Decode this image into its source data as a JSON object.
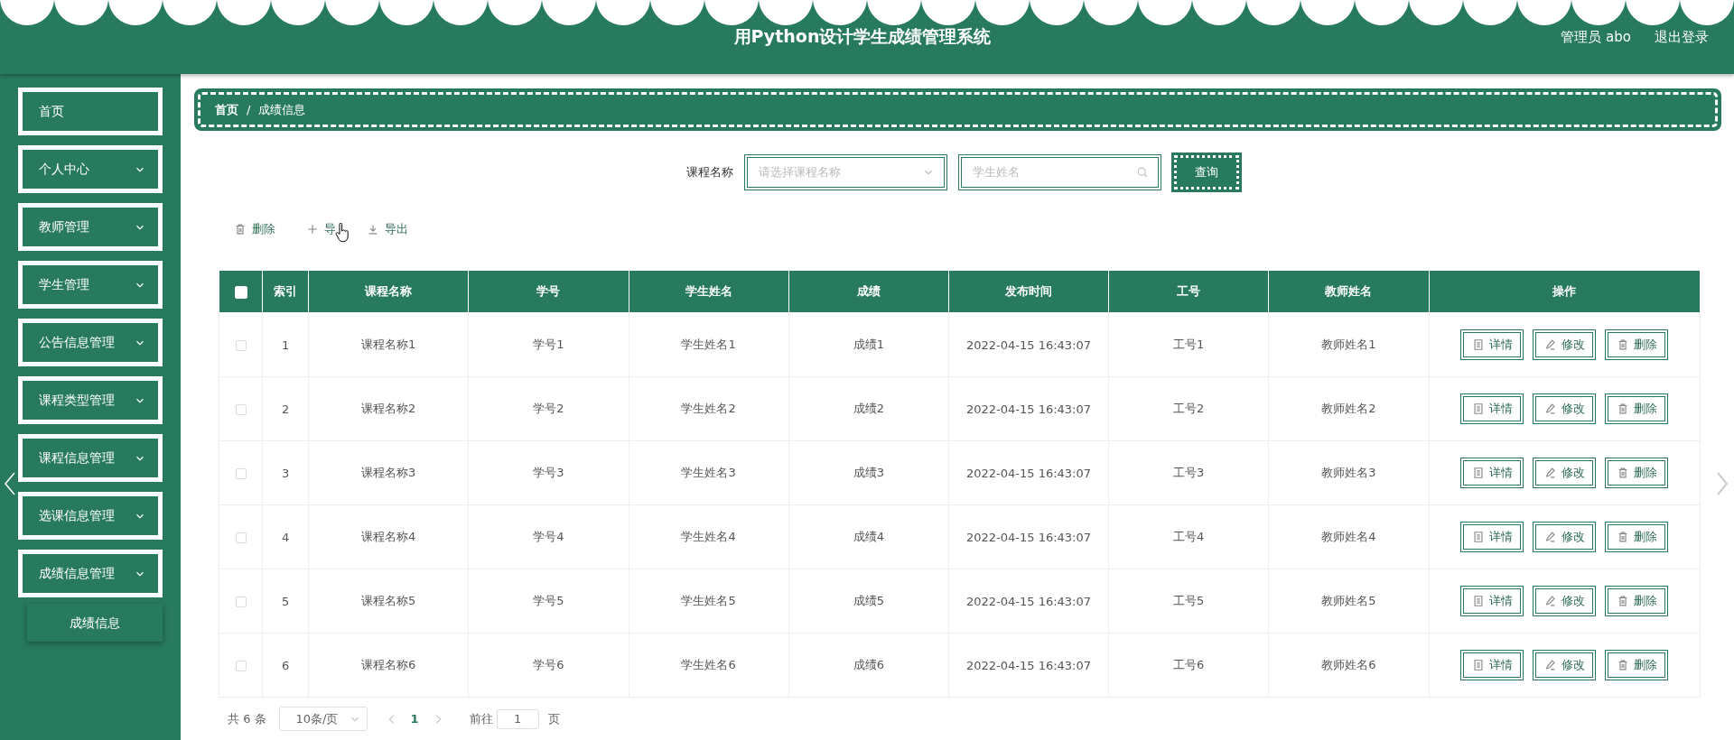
{
  "header": {
    "title": "用Python设计学生成绩管理系统",
    "user": "管理员 abo",
    "logout": "退出登录"
  },
  "sidebar": {
    "items": [
      {
        "label": "首页",
        "kind": "link"
      },
      {
        "label": "个人中心",
        "kind": "submenu"
      },
      {
        "label": "教师管理",
        "kind": "submenu"
      },
      {
        "label": "学生管理",
        "kind": "submenu"
      },
      {
        "label": "公告信息管理",
        "kind": "submenu"
      },
      {
        "label": "课程类型管理",
        "kind": "submenu"
      },
      {
        "label": "课程信息管理",
        "kind": "submenu"
      },
      {
        "label": "选课信息管理",
        "kind": "submenu"
      },
      {
        "label": "成绩信息管理",
        "kind": "submenu",
        "children": [
          {
            "label": "成绩信息"
          }
        ]
      }
    ]
  },
  "breadcrumb": [
    "首页",
    "/",
    "成绩信息"
  ],
  "search": {
    "label": "课程名称",
    "course_select": {
      "placeholder": "请选择课程名称"
    },
    "name_field": {
      "placeholder": "学生姓名"
    },
    "button": "查询"
  },
  "toolbar": [
    {
      "kind": "delete",
      "label": "删除"
    },
    {
      "kind": "add",
      "label": "导"
    },
    {
      "kind": "export",
      "label": "导出"
    }
  ],
  "table": {
    "select_all": {
      "checked": false
    },
    "columns": [
      "索引",
      "课程名称",
      "学号",
      "学生姓名",
      "成绩",
      "发布时间",
      "工号",
      "教师姓名",
      "操作"
    ],
    "rows": [
      {
        "checked": false,
        "cells": [
          "1",
          "课程名称1",
          "学号1",
          "学生姓名1",
          "成绩1",
          "2022-04-15 16:43:07",
          "工号1",
          "教师姓名1"
        ],
        "actions": [
          {
            "kind": "detail",
            "label": "详情"
          },
          {
            "kind": "edit",
            "label": "修改"
          },
          {
            "kind": "delete",
            "label": "删除"
          }
        ]
      },
      {
        "checked": false,
        "cells": [
          "2",
          "课程名称2",
          "学号2",
          "学生姓名2",
          "成绩2",
          "2022-04-15 16:43:07",
          "工号2",
          "教师姓名2"
        ],
        "actions": [
          {
            "kind": "detail",
            "label": "详情"
          },
          {
            "kind": "edit",
            "label": "修改"
          },
          {
            "kind": "delete",
            "label": "删除"
          }
        ]
      },
      {
        "checked": false,
        "cells": [
          "3",
          "课程名称3",
          "学号3",
          "学生姓名3",
          "成绩3",
          "2022-04-15 16:43:07",
          "工号3",
          "教师姓名3"
        ],
        "actions": [
          {
            "kind": "detail",
            "label": "详情"
          },
          {
            "kind": "edit",
            "label": "修改"
          },
          {
            "kind": "delete",
            "label": "删除"
          }
        ]
      },
      {
        "checked": false,
        "cells": [
          "4",
          "课程名称4",
          "学号4",
          "学生姓名4",
          "成绩4",
          "2022-04-15 16:43:07",
          "工号4",
          "教师姓名4"
        ],
        "actions": [
          {
            "kind": "detail",
            "label": "详情"
          },
          {
            "kind": "edit",
            "label": "修改"
          },
          {
            "kind": "delete",
            "label": "删除"
          }
        ]
      },
      {
        "checked": false,
        "cells": [
          "5",
          "课程名称5",
          "学号5",
          "学生姓名5",
          "成绩5",
          "2022-04-15 16:43:07",
          "工号5",
          "教师姓名5"
        ],
        "actions": [
          {
            "kind": "detail",
            "label": "详情"
          },
          {
            "kind": "edit",
            "label": "修改"
          },
          {
            "kind": "delete",
            "label": "删除"
          }
        ]
      },
      {
        "checked": false,
        "cells": [
          "6",
          "课程名称6",
          "学号6",
          "学生姓名6",
          "成绩6",
          "2022-04-15 16:43:07",
          "工号6",
          "教师姓名6"
        ],
        "actions": [
          {
            "kind": "detail",
            "label": "详情"
          },
          {
            "kind": "edit",
            "label": "修改"
          },
          {
            "kind": "delete",
            "label": "删除"
          }
        ]
      }
    ]
  },
  "pagination": {
    "total": "共 6 条",
    "page_size": "10条/页",
    "pages": [
      {
        "label": "1",
        "selected": true
      }
    ],
    "goto_label": "前往",
    "goto_value": "1",
    "goto_suffix": "页"
  }
}
